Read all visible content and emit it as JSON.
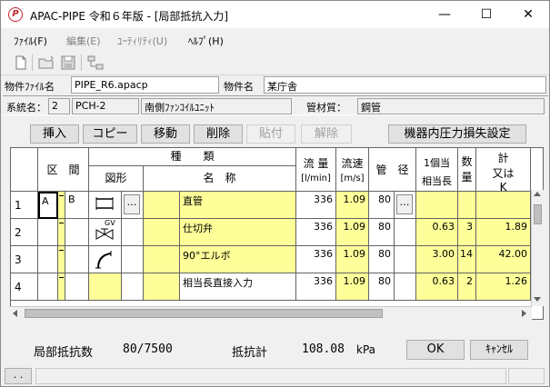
{
  "window": {
    "title": "APAC-PIPE 令和６年版 - [局部抵抗入力]",
    "minimize": "—",
    "maximize": "☐",
    "close": "✕"
  },
  "menu": {
    "file": "ﾌｧｲﾙ(F)",
    "edit": "編集(E)",
    "utility": "ﾕｰﾃｨﾘﾃｨ(U)",
    "help": "ﾍﾙﾌﾟ(H)"
  },
  "toolbar": {
    "icons": [
      "new-file-icon",
      "open-folder-icon",
      "save-icon",
      "network-icon"
    ]
  },
  "header": {
    "file_label": "物件ﾌｧｲﾙ名",
    "file_value": "PIPE_R6.apacp",
    "name_label": "物件名",
    "name_value": "某庁舎"
  },
  "system": {
    "sys_label": "系統名：",
    "sys_no": "2",
    "sys_name": "PCH-2",
    "sys_desc": "南側ﾌｧﾝｺｲﾙﾕﾆｯﾄ",
    "material_label": "管材質：",
    "material_value": "鋼管"
  },
  "actions": {
    "insert": "挿入",
    "copy": "コピー",
    "move": "移動",
    "delete": "削除",
    "paste": "貼付",
    "release": "解除",
    "equipment": "機器内圧力損失設定"
  },
  "grid": {
    "headers": {
      "section": "区　間",
      "kind": "種　　類",
      "figure": "図形",
      "name": "名　称",
      "flow": "流 量",
      "flow_unit": "[l/min]",
      "velocity": "流速",
      "velocity_unit": "[m/s]",
      "pipe": "管　径",
      "per_equiv1": "1個当",
      "per_equiv2": "相当長",
      "qty1": "数",
      "qty2": "量",
      "total1": "計",
      "total2": "又は",
      "total3": "K"
    },
    "rows": [
      {
        "no": "1",
        "from": "A",
        "to": "B",
        "name": "直管",
        "flow": "336",
        "velocity": "1.09",
        "pipe": "80",
        "equiv": "",
        "qty": "",
        "total": ""
      },
      {
        "no": "2",
        "from": "",
        "to": "",
        "name": "仕切弁",
        "flow": "336",
        "velocity": "1.09",
        "pipe": "80",
        "equiv": "0.63",
        "qty": "3",
        "total": "1.89",
        "fig_label": "GV"
      },
      {
        "no": "3",
        "from": "",
        "to": "",
        "name": "90°エルボ",
        "flow": "336",
        "velocity": "1.09",
        "pipe": "80",
        "equiv": "3.00",
        "qty": "14",
        "total": "42.00"
      },
      {
        "no": "4",
        "from": "",
        "to": "",
        "name": "相当長直接入力",
        "flow": "336",
        "velocity": "1.09",
        "pipe": "80",
        "equiv": "0.63",
        "qty": "2",
        "total": "1.26"
      }
    ],
    "ellipsis": "…"
  },
  "footer": {
    "count_label": "局部抵抗数",
    "count_value": "80/7500",
    "total_label": "抵抗計",
    "total_value": "108.08",
    "total_unit": "kPa",
    "ok": "OK",
    "cancel": "ｷｬﾝｾﾙ",
    "status_btn": ". ."
  },
  "colors": {
    "yellow": "#ffff99",
    "icon_red": "#c0272d"
  }
}
